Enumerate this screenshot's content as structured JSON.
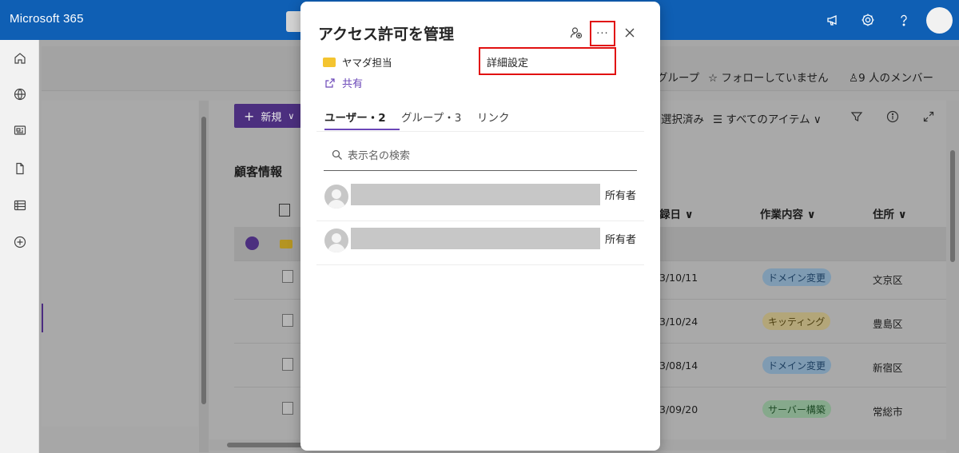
{
  "app": {
    "brand": "Microsoft 365"
  },
  "site_header": {
    "group_label": "グループ",
    "follow_label": "フォローしていません",
    "members_label": "9 人のメンバー"
  },
  "commandbar": {
    "new_label": "新規",
    "selected_label": "選択済み",
    "view_label": "すべてのアイテム"
  },
  "list": {
    "title": "顧客情報",
    "columns": [
      "録日",
      "作業内容",
      "住所"
    ],
    "rows": [
      {
        "date": "3/10/11",
        "task": "ドメイン変更",
        "addr": "文京区",
        "color": "blue"
      },
      {
        "date": "3/10/24",
        "task": "キッティング",
        "addr": "豊島区",
        "color": "yellow"
      },
      {
        "date": "3/08/14",
        "task": "ドメイン変更",
        "addr": "新宿区",
        "color": "blue"
      },
      {
        "date": "3/09/20",
        "task": "サーバー構築",
        "addr": "常総市",
        "color": "green"
      }
    ]
  },
  "dialog": {
    "title": "アクセス許可を管理",
    "menu_item": "詳細設定",
    "folder_name": "ヤマダ担当",
    "share_label": "共有",
    "tabs": [
      {
        "label": "ユーザー・2",
        "active": true
      },
      {
        "label": "グループ・3",
        "active": false
      },
      {
        "label": "リンク",
        "active": false
      }
    ],
    "search_placeholder": "表示名の検索",
    "users": [
      {
        "role": "所有者"
      },
      {
        "role": "所有者"
      }
    ]
  },
  "colors": {
    "suite_bar": "#0f5fb4",
    "accent_purple": "#6b47b8",
    "highlight_red": "#e11010"
  }
}
